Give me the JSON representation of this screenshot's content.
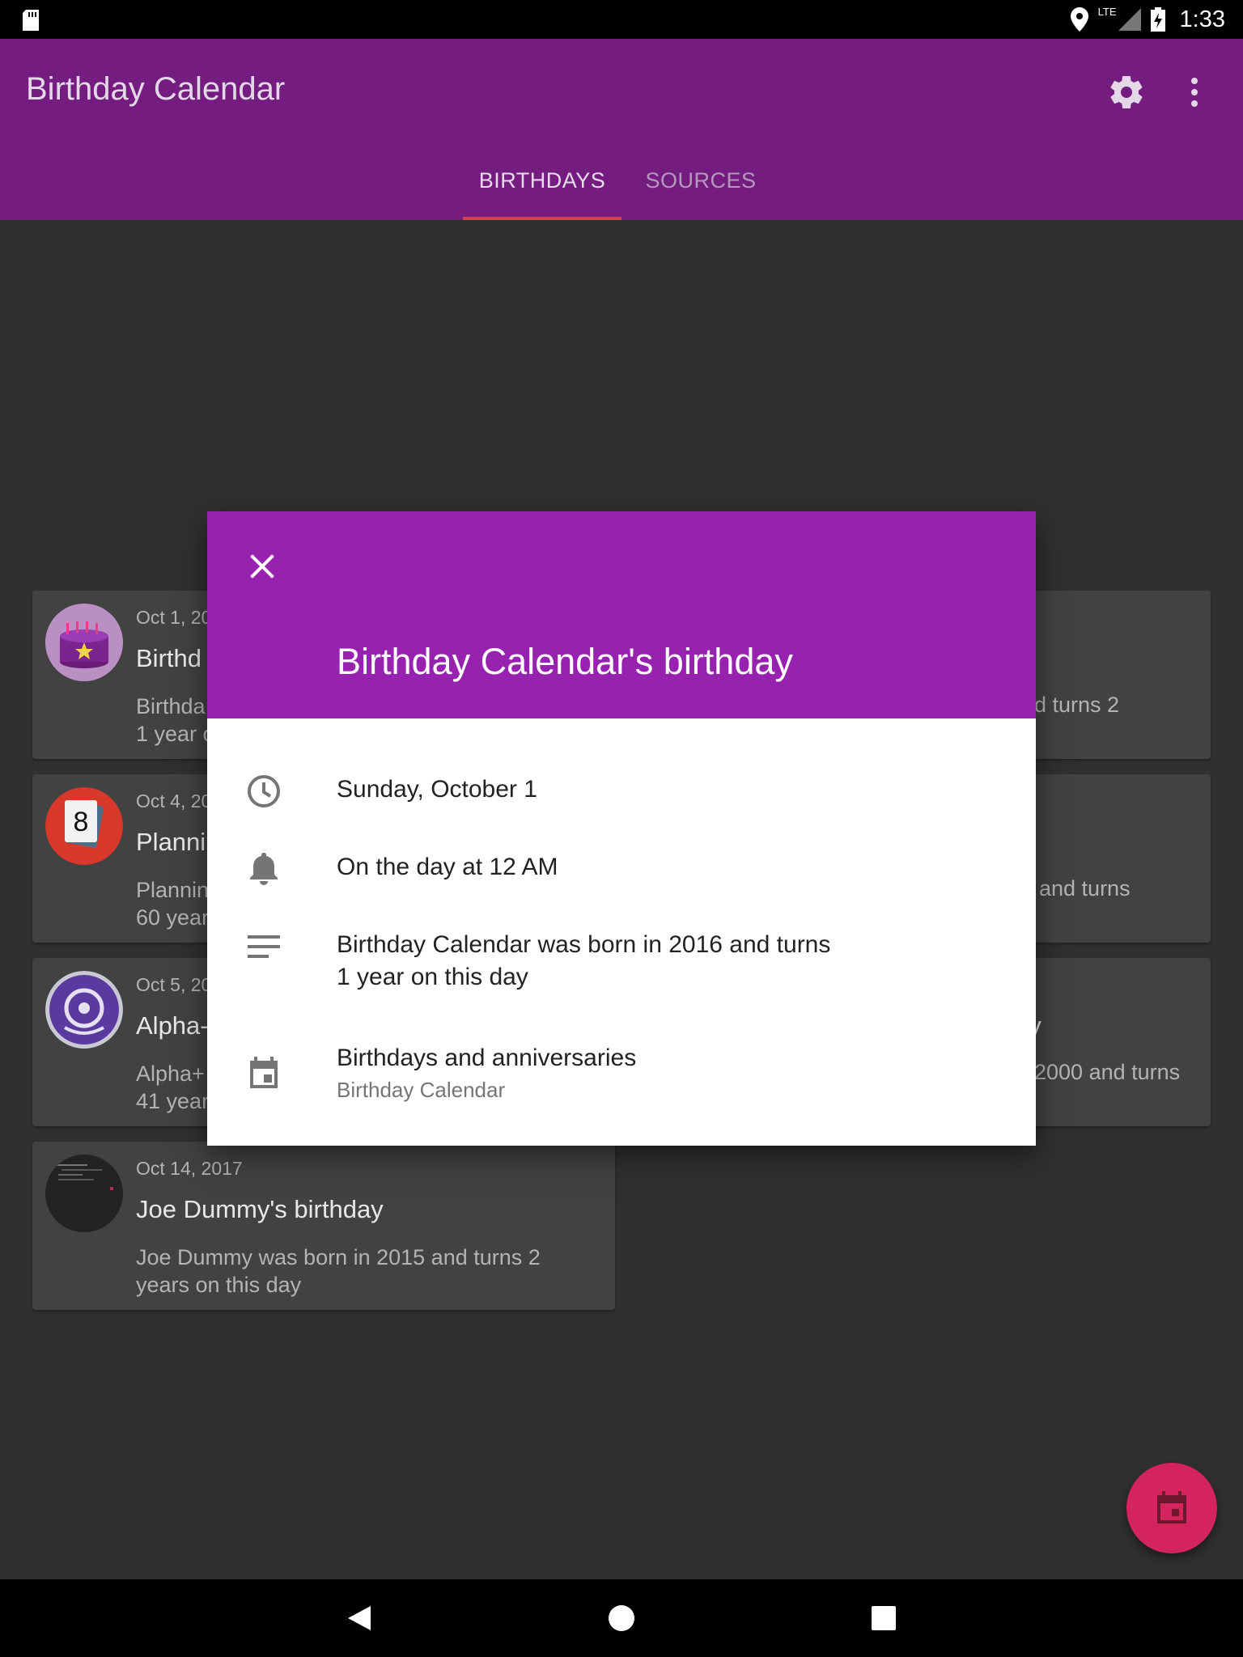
{
  "status_bar": {
    "time": "1:33",
    "network": "LTE",
    "icons": [
      "sd-card-icon",
      "location-icon",
      "signal-icon",
      "battery-charging-icon"
    ]
  },
  "app_bar": {
    "title": "Birthday Calendar",
    "actions": [
      "gear-icon",
      "more-vert-icon"
    ],
    "color": "#741c80"
  },
  "tabs": [
    {
      "label": "BIRTHDAYS",
      "selected": true
    },
    {
      "label": "SOURCES",
      "selected": false
    }
  ],
  "birthdays": [
    {
      "date": "Oct 1, 20",
      "title": "Birthd",
      "desc_lines": [
        "Birthda",
        "1 year o"
      ],
      "right_text": "d turns 2",
      "avatar": "cake-icon"
    },
    {
      "date": "Oct 4, 20",
      "title": "Planni",
      "desc_lines": [
        "Plannin",
        "60 year"
      ],
      "right_text": "and turns",
      "avatar": "playing-card-icon"
    },
    {
      "date": "Oct 5, 20",
      "title": "Alpha-",
      "desc_lines": [
        "Alpha+",
        "41 year"
      ],
      "right_title": "ay",
      "right_text": "2000 and turns",
      "avatar": "disc-icon"
    },
    {
      "date": "Oct 14, 2017",
      "title": "Joe Dummy's birthday",
      "desc_lines": [
        "Joe Dummy was born in 2015 and turns 2",
        "years on this day"
      ],
      "avatar": "screenshot-avatar"
    }
  ],
  "dialog": {
    "title": "Birthday Calendar's birthday",
    "header_color": "#9722b0",
    "date": "Sunday, October 1",
    "reminder": "On the day at 12 AM",
    "description_lines": [
      "Birthday Calendar was born in 2016 and turns",
      "1 year on this day"
    ],
    "calendar_name": "Birthdays and anniversaries",
    "calendar_account": "Birthday Calendar"
  },
  "fab": {
    "icon": "calendar-icon",
    "color": "#d4245e"
  },
  "nav_bar": {
    "buttons": [
      "back-icon",
      "home-icon",
      "recents-icon"
    ]
  }
}
